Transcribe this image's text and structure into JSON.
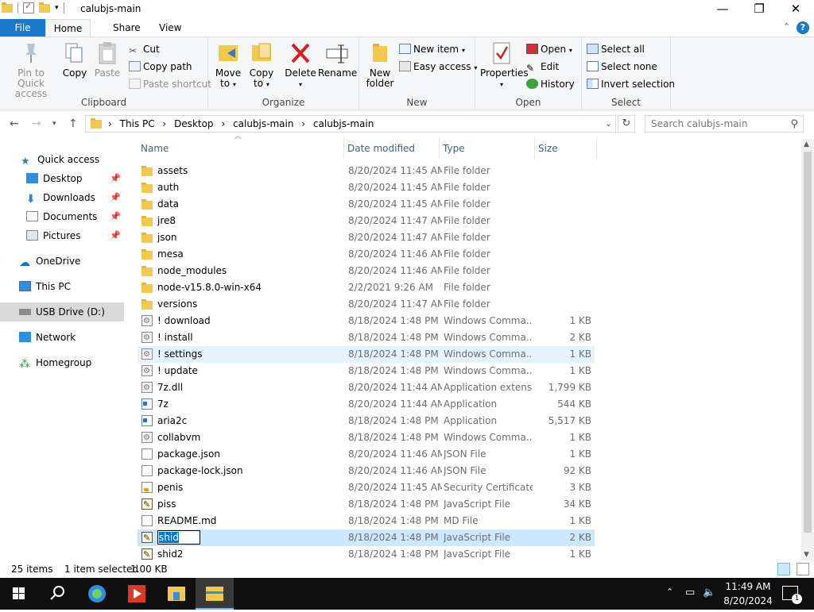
{
  "window": {
    "title": "calubjs-main",
    "buttons": {
      "minimize": "—",
      "maximize": "❐",
      "close": "✕"
    }
  },
  "ribbon_tabs": {
    "file": "File",
    "home": "Home",
    "share": "Share",
    "view": "View"
  },
  "ribbon": {
    "clipboard": {
      "label": "Clipboard",
      "pin_line1": "Pin to Quick",
      "pin_line2": "access",
      "copy": "Copy",
      "paste": "Paste",
      "cut": "Cut",
      "copy_path": "Copy path",
      "paste_shortcut": "Paste shortcut"
    },
    "organize": {
      "label": "Organize",
      "move_to_line1": "Move",
      "move_to_line2": "to",
      "copy_to_line1": "Copy",
      "copy_to_line2": "to",
      "delete": "Delete",
      "rename": "Rename"
    },
    "new": {
      "label": "New",
      "new_folder_line1": "New",
      "new_folder_line2": "folder",
      "new_item": "New item",
      "easy_access": "Easy access"
    },
    "open": {
      "label": "Open",
      "properties": "Properties",
      "open": "Open",
      "edit": "Edit",
      "history": "History"
    },
    "select": {
      "label": "Select",
      "select_all": "Select all",
      "select_none": "Select none",
      "invert_selection": "Invert selection"
    }
  },
  "address": {
    "crumbs": [
      "This PC",
      "Desktop",
      "calubjs-main",
      "calubjs-main"
    ],
    "search_placeholder": "Search calubjs-main"
  },
  "nav": {
    "quick_access": "Quick access",
    "desktop": "Desktop",
    "downloads": "Downloads",
    "documents": "Documents",
    "pictures": "Pictures",
    "onedrive": "OneDrive",
    "this_pc": "This PC",
    "usb": "USB Drive (D:)",
    "network": "Network",
    "homegroup": "Homegroup"
  },
  "columns": {
    "name": "Name",
    "date": "Date modified",
    "type": "Type",
    "size": "Size"
  },
  "files": [
    {
      "name": "assets",
      "date": "8/20/2024 11:45 AM",
      "type": "File folder",
      "size": "",
      "icon": "folder"
    },
    {
      "name": "auth",
      "date": "8/20/2024 11:45 AM",
      "type": "File folder",
      "size": "",
      "icon": "folder"
    },
    {
      "name": "data",
      "date": "8/20/2024 11:45 AM",
      "type": "File folder",
      "size": "",
      "icon": "folder"
    },
    {
      "name": "jre8",
      "date": "8/20/2024 11:47 AM",
      "type": "File folder",
      "size": "",
      "icon": "folder"
    },
    {
      "name": "json",
      "date": "8/20/2024 11:47 AM",
      "type": "File folder",
      "size": "",
      "icon": "folder"
    },
    {
      "name": "mesa",
      "date": "8/20/2024 11:46 AM",
      "type": "File folder",
      "size": "",
      "icon": "folder"
    },
    {
      "name": "node_modules",
      "date": "8/20/2024 11:46 AM",
      "type": "File folder",
      "size": "",
      "icon": "folder"
    },
    {
      "name": "node-v15.8.0-win-x64",
      "date": "2/2/2021 9:26 AM",
      "type": "File folder",
      "size": "",
      "icon": "folder"
    },
    {
      "name": "versions",
      "date": "8/20/2024 11:47 AM",
      "type": "File folder",
      "size": "",
      "icon": "folder"
    },
    {
      "name": "! download",
      "date": "8/18/2024 1:48 PM",
      "type": "Windows Comma...",
      "size": "1 KB",
      "icon": "cmd"
    },
    {
      "name": "! install",
      "date": "8/18/2024 1:48 PM",
      "type": "Windows Comma...",
      "size": "2 KB",
      "icon": "cmd"
    },
    {
      "name": "! settings",
      "date": "8/18/2024 1:48 PM",
      "type": "Windows Comma...",
      "size": "1 KB",
      "icon": "cmd"
    },
    {
      "name": "! update",
      "date": "8/18/2024 1:48 PM",
      "type": "Windows Comma...",
      "size": "1 KB",
      "icon": "cmd"
    },
    {
      "name": "7z.dll",
      "date": "8/20/2024 11:44 AM",
      "type": "Application extens...",
      "size": "1,799 KB",
      "icon": "cmd"
    },
    {
      "name": "7z",
      "date": "8/20/2024 11:44 AM",
      "type": "Application",
      "size": "544 KB",
      "icon": "exe"
    },
    {
      "name": "aria2c",
      "date": "8/18/2024 1:48 PM",
      "type": "Application",
      "size": "5,517 KB",
      "icon": "exe"
    },
    {
      "name": "collabvm",
      "date": "8/18/2024 1:48 PM",
      "type": "Windows Comma...",
      "size": "1 KB",
      "icon": "cmd"
    },
    {
      "name": "package.json",
      "date": "8/20/2024 11:46 AM",
      "type": "JSON File",
      "size": "1 KB",
      "icon": "doc"
    },
    {
      "name": "package-lock.json",
      "date": "8/20/2024 11:46 AM",
      "type": "JSON File",
      "size": "92 KB",
      "icon": "doc"
    },
    {
      "name": "penis",
      "date": "8/20/2024 11:45 AM",
      "type": "Security Certificate",
      "size": "3 KB",
      "icon": "cert"
    },
    {
      "name": "piss",
      "date": "8/18/2024 1:48 PM",
      "type": "JavaScript File",
      "size": "34 KB",
      "icon": "js"
    },
    {
      "name": "README.md",
      "date": "8/18/2024 1:48 PM",
      "type": "MD File",
      "size": "1 KB",
      "icon": "doc"
    },
    {
      "name": "shid",
      "date": "8/18/2024 1:48 PM",
      "type": "JavaScript File",
      "size": "2 KB",
      "icon": "js"
    },
    {
      "name": "shid2",
      "date": "8/18/2024 1:48 PM",
      "type": "JavaScript File",
      "size": "1 KB",
      "icon": "js"
    }
  ],
  "hover_row": 11,
  "selected_row": 22,
  "rename_value": "shid",
  "status": {
    "count": "25 items",
    "selected": "1 item selected",
    "size": "1.00 KB"
  },
  "clock": {
    "time": "11:49 AM",
    "date": "8/20/2024"
  },
  "notification_count": "1",
  "colors": {
    "accent": "#1979ca",
    "selection": "#cce8ff",
    "hover": "#e5f3ff",
    "taskbar": "#101010"
  }
}
